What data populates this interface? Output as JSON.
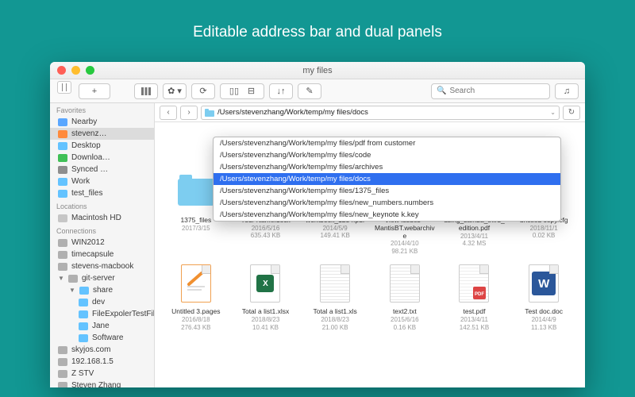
{
  "tagline": "Editable address bar and dual panels",
  "window_title": "my files",
  "search_placeholder": "Search",
  "address_value": "/Users/stevenzhang/Work/temp/my files/docs",
  "dropdown": [
    "/Users/stevenzhang/Work/temp/my files/pdf from customer",
    "/Users/stevenzhang/Work/temp/my files/code",
    "/Users/stevenzhang/Work/temp/my files/archives",
    "/Users/stevenzhang/Work/temp/my files/docs",
    "/Users/stevenzhang/Work/temp/my files/1375_files",
    "/Users/stevenzhang/Work/temp/my files/new_numbers.numbers",
    "/Users/stevenzhang/Work/temp/my files/new_keynote k.key"
  ],
  "dropdown_selected": 3,
  "sidebar": {
    "groups": [
      {
        "head": "Favorites",
        "items": [
          {
            "icon": "#5aa7ff",
            "label": "Nearby"
          },
          {
            "icon": "#ff8a3c",
            "label": "stevenz…",
            "sel": true
          },
          {
            "icon": "#64c3ff",
            "label": "Desktop"
          },
          {
            "icon": "#40c057",
            "label": "Downloa…"
          },
          {
            "icon": "#8e8e8e",
            "label": "Synced …"
          },
          {
            "icon": "#64c3ff",
            "label": "Work"
          },
          {
            "icon": "#64c3ff",
            "label": "test_files"
          }
        ]
      },
      {
        "head": "Locations",
        "items": [
          {
            "icon": "#c6c6c6",
            "label": "Macintosh HD"
          }
        ]
      },
      {
        "head": "Connections",
        "items": [
          {
            "icon": "#b0b0b0",
            "label": "WIN2012"
          },
          {
            "icon": "#b0b0b0",
            "label": "timecapsule"
          },
          {
            "icon": "#b0b0b0",
            "label": "stevens-macbook"
          },
          {
            "icon": "#b0b0b0",
            "label": "git-server",
            "open": true,
            "children": [
              {
                "icon": "#64c3ff",
                "label": "share",
                "open": true,
                "children": [
                  {
                    "icon": "#64c3ff",
                    "label": "dev"
                  },
                  {
                    "icon": "#64c3ff",
                    "label": "FileExpolerTestFiles"
                  },
                  {
                    "icon": "#64c3ff",
                    "label": "Jane"
                  },
                  {
                    "icon": "#64c3ff",
                    "label": "Software"
                  }
                ]
              }
            ]
          },
          {
            "icon": "#b0b0b0",
            "label": "skyjos.com"
          },
          {
            "icon": "#b0b0b0",
            "label": "192.168.1.5"
          },
          {
            "icon": "#b0b0b0",
            "label": "Z STV"
          },
          {
            "icon": "#b0b0b0",
            "label": "Steven Zhang"
          }
        ]
      }
    ]
  },
  "files": [
    {
      "type": "folder",
      "name": "1375_files",
      "date": "2017/3/15",
      "size": ""
    },
    {
      "type": "docx",
      "name": "Your Name.docx",
      "date": "2016/5/16",
      "size": "635.43 KB"
    },
    {
      "type": "pdf",
      "name": "workbook_1234.pdf",
      "date": "2014/5/9",
      "size": "149.41 KB"
    },
    {
      "type": "archive",
      "name": "View Issues - MantisBT.webarchive",
      "date": "2014/4/10",
      "size": "98.21 KB"
    },
    {
      "type": "pdf",
      "name": "using_samba_third_edition.pdf",
      "date": "2013/4/11",
      "size": "4.32 MS"
    },
    {
      "type": "cfg",
      "name": "untitled copy.cfg",
      "date": "2018/11/1",
      "size": "0.02 KB"
    },
    {
      "type": "pages",
      "name": "Untitled 3.pages",
      "date": "2016/8/18",
      "size": "276.43 KB"
    },
    {
      "type": "xlsx",
      "name": "Total a list1.xlsx",
      "date": "2018/8/23",
      "size": "10.41 KB"
    },
    {
      "type": "xls",
      "name": "Total a list1.xls",
      "date": "2018/8/23",
      "size": "21.00 KB"
    },
    {
      "type": "txt",
      "name": "text2.txt",
      "date": "2015/6/16",
      "size": "0.16 KB"
    },
    {
      "type": "pdf2",
      "name": "test.pdf",
      "date": "2013/4/11",
      "size": "142.51 KB"
    },
    {
      "type": "doc",
      "name": "Test doc.doc",
      "date": "2014/4/9",
      "size": "11.13 KB"
    }
  ]
}
